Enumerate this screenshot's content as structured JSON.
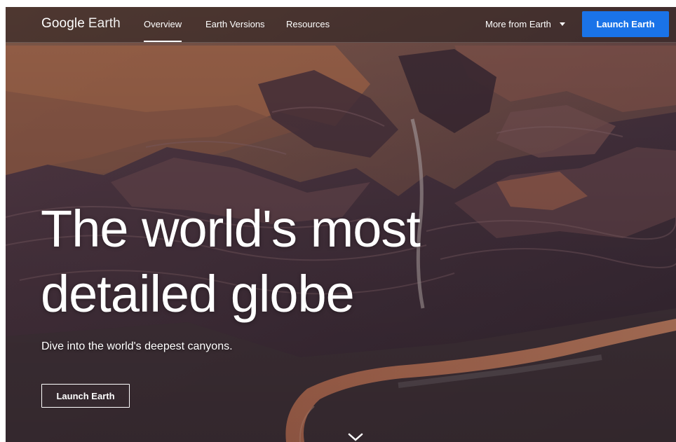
{
  "header": {
    "logo_brand": "Google",
    "logo_product": "Earth",
    "nav": [
      {
        "label": "Overview",
        "active": true
      },
      {
        "label": "Earth Versions",
        "active": false
      },
      {
        "label": "Resources",
        "active": false
      }
    ],
    "more_label": "More from Earth",
    "launch_label": "Launch Earth"
  },
  "hero": {
    "headline_line1": "The world's most",
    "headline_line2": "detailed globe",
    "subheading": "Dive into the world's deepest canyons.",
    "cta_label": "Launch Earth",
    "scroll_icon": "chevron-down-icon"
  },
  "colors": {
    "accent": "#1a73e8",
    "text": "#ffffff",
    "nav_overlay": "#261e1e"
  }
}
